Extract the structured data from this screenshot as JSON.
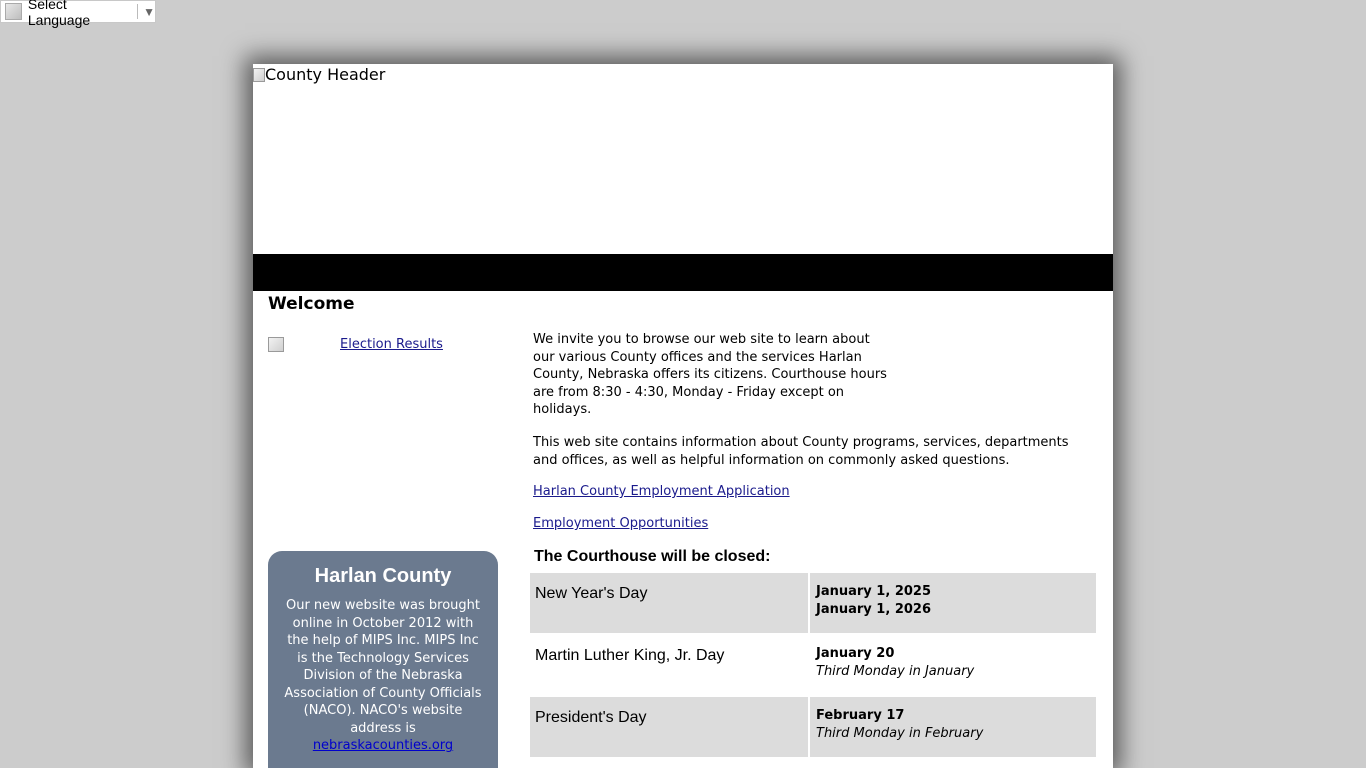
{
  "language_selector": {
    "label": "Select Language",
    "arrow": "▼"
  },
  "header": {
    "image_alt": "County Header"
  },
  "welcome": {
    "title": "Welcome"
  },
  "sidebar": {
    "election_link": "Election Results",
    "county_box": {
      "title": "Harlan County",
      "text": "Our new website was brought online in October 2012 with the help of MIPS Inc.  MIPS Inc is the Technology Services Division of the Nebraska Association of County Officials (NACO).  NACO's website address is",
      "link": "nebraskacounties.org"
    }
  },
  "main": {
    "intro": "We invite you to browse our web site to learn about our various County offices and the services Harlan County, Nebraska offers its citizens. Courthouse hours are from 8:30 - 4:30, Monday - Friday except on holidays.",
    "info": "This web site contains information about County programs, services, departments and offices, as well as helpful information on commonly asked questions.",
    "links": [
      "Harlan County Employment Application",
      "Employment Opportunities"
    ],
    "closed_title": "The Courthouse will be closed:",
    "holidays": [
      {
        "name": "New Year's Day",
        "dates": [
          "January 1, 2025",
          "January 1, 2026"
        ],
        "rule": ""
      },
      {
        "name": "Martin Luther King, Jr. Day",
        "dates": [
          "January 20"
        ],
        "rule": "Third Monday in January"
      },
      {
        "name": "President's Day",
        "dates": [
          "February 17"
        ],
        "rule": "Third Monday in February"
      }
    ]
  }
}
